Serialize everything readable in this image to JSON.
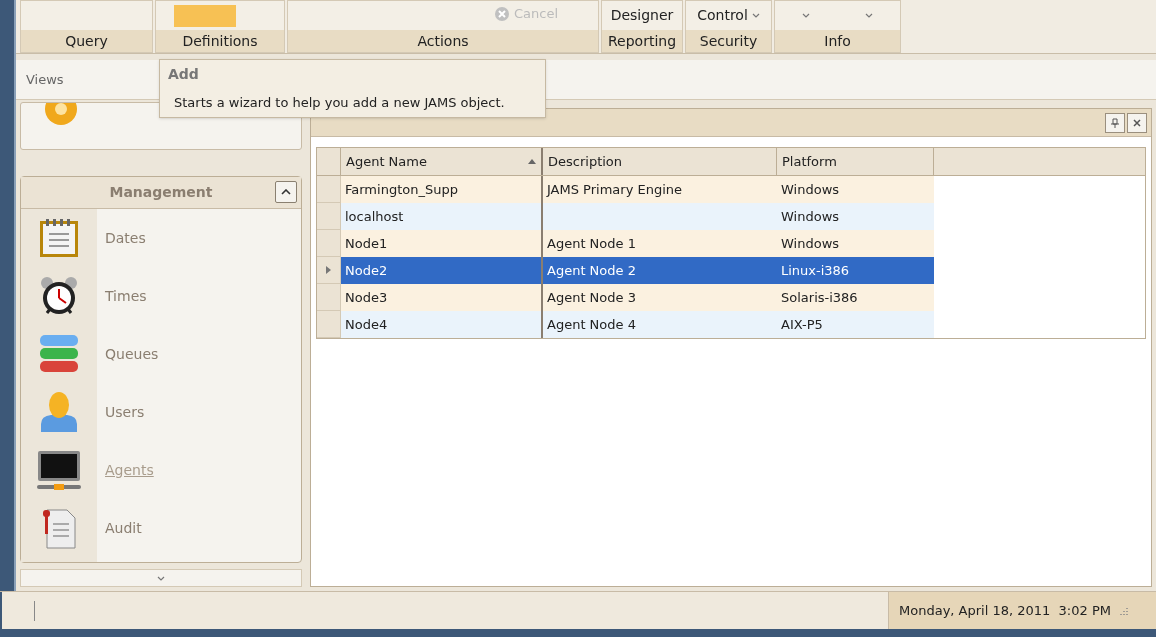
{
  "ribbon": {
    "groups": [
      {
        "label": "Query"
      },
      {
        "label": "Definitions",
        "buttons": [
          {
            "kind": "icon"
          }
        ]
      },
      {
        "label": "Actions",
        "buttons": [
          {
            "kind": "cancel",
            "label": "Cancel",
            "disabled": true
          }
        ]
      },
      {
        "label": "Reporting",
        "buttons": [
          {
            "kind": "text",
            "label": "Designer",
            "dropdown": false
          }
        ]
      },
      {
        "label": "Security",
        "buttons": [
          {
            "kind": "text",
            "label": "Control",
            "dropdown": true
          }
        ]
      },
      {
        "label": "Info",
        "buttons": [
          {
            "kind": "caret"
          },
          {
            "kind": "caret"
          }
        ]
      }
    ]
  },
  "views": {
    "label": "Views"
  },
  "tooltip": {
    "title": "Add",
    "text": "Starts a wizard to help you add a new JAMS object."
  },
  "management": {
    "title": "Management",
    "expanded": true,
    "items": [
      {
        "label": "Dates",
        "selected": false
      },
      {
        "label": "Times",
        "selected": false
      },
      {
        "label": "Queues",
        "selected": false
      },
      {
        "label": "Users",
        "selected": false
      },
      {
        "label": "Agents",
        "selected": true
      },
      {
        "label": "Audit",
        "selected": false
      }
    ]
  },
  "table": {
    "columns": [
      {
        "label": "Agent Name",
        "sorted": true
      },
      {
        "label": "Description",
        "sorted": false
      },
      {
        "label": "Platform",
        "sorted": false
      }
    ],
    "rows": [
      {
        "cells": [
          "Farmington_Supp",
          "JAMS Primary Engine",
          "Windows"
        ],
        "selected": false
      },
      {
        "cells": [
          "localhost",
          "",
          "Windows"
        ],
        "selected": false
      },
      {
        "cells": [
          "Node1",
          "Agent Node 1",
          "Windows"
        ],
        "selected": false
      },
      {
        "cells": [
          "Node2",
          "Agent Node 2",
          "Linux-i386"
        ],
        "selected": true
      },
      {
        "cells": [
          "Node3",
          "Agent Node 3",
          "Solaris-i386"
        ],
        "selected": false
      },
      {
        "cells": [
          "Node4",
          "Agent Node 4",
          "AIX-P5"
        ],
        "selected": false
      }
    ]
  },
  "status_bar": {
    "datetime": "Monday, April 18, 2011  3:02 PM"
  }
}
